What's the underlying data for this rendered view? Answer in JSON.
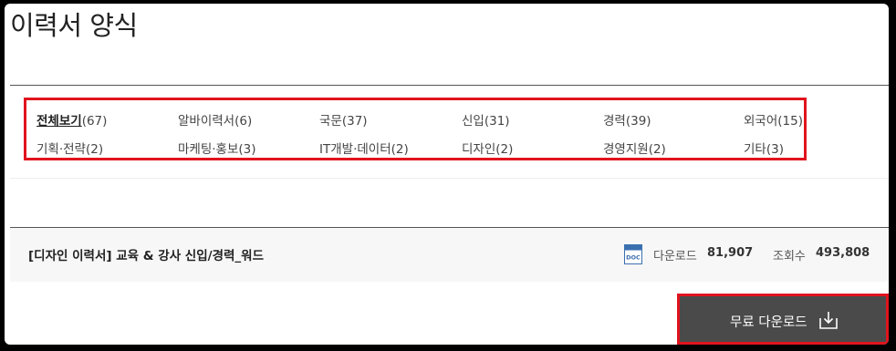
{
  "page": {
    "title": "이력서 양식"
  },
  "categories": [
    {
      "name": "전체보기",
      "count": "(67)",
      "active": true
    },
    {
      "name": "알바이력서",
      "count": "(6)"
    },
    {
      "name": "국문",
      "count": "(37)"
    },
    {
      "name": "신입",
      "count": "(31)"
    },
    {
      "name": "경력",
      "count": "(39)"
    },
    {
      "name": "외국어",
      "count": "(15)"
    },
    {
      "name": "기획·전략",
      "count": "(2)"
    },
    {
      "name": "마케팅·홍보",
      "count": "(3)"
    },
    {
      "name": "IT개발·데이터",
      "count": "(2)"
    },
    {
      "name": "디자인",
      "count": "(2)"
    },
    {
      "name": "경영지원",
      "count": "(2)"
    },
    {
      "name": "기타",
      "count": "(3)"
    }
  ],
  "document": {
    "title": "[디자인 이력서] 교육 & 강사 신입/경력_워드",
    "icon": "doc-file-icon",
    "icon_text": "DOC",
    "download_label": "다운로드",
    "download_count": "81,907",
    "views_label": "조회수",
    "views_count": "493,808"
  },
  "download_button": {
    "label": "무료 다운로드",
    "icon": "download-tray-icon"
  },
  "colors": {
    "highlight": "#e0141e",
    "button_bg": "#4a4a4a",
    "doc_icon": "#3a6fb0"
  }
}
